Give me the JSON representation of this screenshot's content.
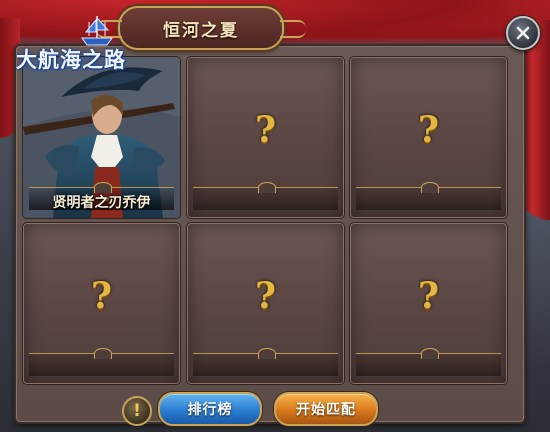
{
  "window": {
    "title": "恒河之夏",
    "logo_text": "大航海之路"
  },
  "slots": [
    {
      "label": "贤明者之刃乔伊",
      "filled": true
    },
    {
      "label": "?",
      "filled": false
    },
    {
      "label": "?",
      "filled": false
    },
    {
      "label": "?",
      "filled": false
    },
    {
      "label": "?",
      "filled": false
    },
    {
      "label": "?",
      "filled": false
    }
  ],
  "actions": {
    "info_label": "!",
    "leaderboard_label": "排行榜",
    "start_match_label": "开始匹配"
  },
  "icons": {
    "close": "close-icon",
    "info": "exclamation-icon",
    "logo": "ship-logo-icon"
  },
  "colors": {
    "accent_gold": "#c8a45a",
    "question_gold": "#e3b642",
    "curtain_red": "#c4262a",
    "button_blue": "#2a7dd0",
    "button_orange": "#d87a1c"
  }
}
